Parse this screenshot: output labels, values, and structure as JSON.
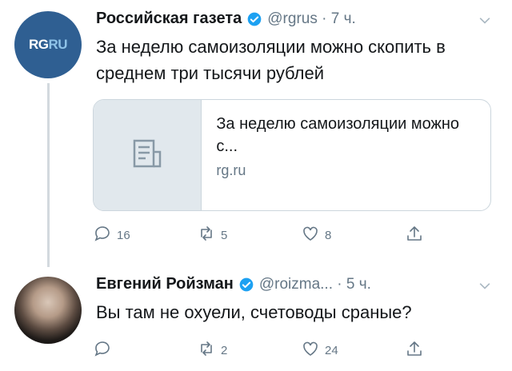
{
  "tweets": [
    {
      "avatar_text_a": "RG",
      "avatar_text_b": "RU",
      "name": "Российская газета",
      "handle": "@rgrus · 7 ч.",
      "text": "За неделю самоизоляции можно скопить в среднем три тысячи рублей",
      "card": {
        "title": "За неделю самоизоляции можно с...",
        "domain": "rg.ru"
      },
      "actions": {
        "replies": "16",
        "retweets": "5",
        "likes": "8"
      }
    },
    {
      "name": "Евгений Ройзман",
      "handle": "@roizma... · 5 ч.",
      "text": "Вы там не охуели, счетоводы сраные?",
      "actions": {
        "replies": "",
        "retweets": "2",
        "likes": "24"
      }
    }
  ],
  "colors": {
    "text": "#14171a",
    "muted": "#657786",
    "verified": "#1da1f2",
    "avatar_bg": "#2f5f92"
  },
  "icons": [
    "verified-icon",
    "chevron-down-icon",
    "reply-icon",
    "retweet-icon",
    "like-icon",
    "share-icon",
    "document-icon"
  ]
}
